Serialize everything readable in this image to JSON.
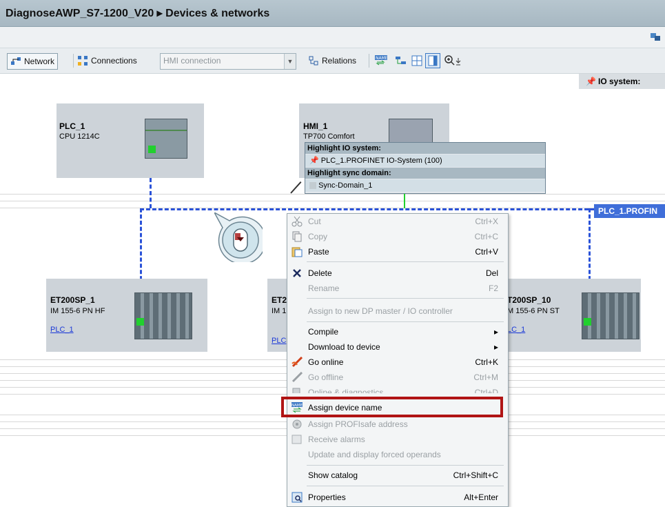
{
  "window": {
    "title": "DiagnoseAWP_S7-1200_V20  ▸  Devices & networks"
  },
  "toolbar": {
    "network": "Network",
    "connections": "Connections",
    "hmi_placeholder": "HMI connection",
    "relations": "Relations"
  },
  "io_header": {
    "label": "IO system:"
  },
  "devices": [
    {
      "name": "PLC_1",
      "type": "CPU 1214C",
      "link": ""
    },
    {
      "name": "HMI_1",
      "type": "TP700 Comfort",
      "link": ""
    },
    {
      "name": "ET200SP_1",
      "type": "IM 155-6 PN HF",
      "link": "PLC_1"
    },
    {
      "name": "ET2",
      "type": "IM 1",
      "link": "PLC"
    },
    {
      "name": "T200SP_10",
      "type": "M 155-6 PN ST",
      "link": "LC_1"
    }
  ],
  "network_label": "PLC_1.PROFIN",
  "tooltip": {
    "io_header": "Highlight IO system:",
    "io_item": "PLC_1.PROFINET IO-System (100)",
    "sync_header": "Highlight sync domain:",
    "sync_item": "Sync-Domain_1"
  },
  "menu": [
    {
      "label": "Cut",
      "shortcut": "Ctrl+X",
      "enabled": false,
      "icon": "cut-icon"
    },
    {
      "label": "Copy",
      "shortcut": "Ctrl+C",
      "enabled": false,
      "icon": "copy-icon"
    },
    {
      "label": "Paste",
      "shortcut": "Ctrl+V",
      "enabled": true,
      "icon": "paste-icon"
    },
    {
      "label": "Delete",
      "shortcut": "Del",
      "enabled": true,
      "icon": "delete-icon"
    },
    {
      "label": "Rename",
      "shortcut": "F2",
      "enabled": false,
      "icon": ""
    },
    {
      "label": "Assign to new DP master / IO controller",
      "shortcut": "",
      "enabled": false,
      "icon": ""
    },
    {
      "label": "Compile",
      "shortcut": "▸",
      "enabled": true,
      "icon": ""
    },
    {
      "label": "Download to device",
      "shortcut": "▸",
      "enabled": true,
      "icon": ""
    },
    {
      "label": "Go online",
      "shortcut": "Ctrl+K",
      "enabled": true,
      "icon": "go-online-icon"
    },
    {
      "label": "Go offline",
      "shortcut": "Ctrl+M",
      "enabled": false,
      "icon": "go-offline-icon"
    },
    {
      "label": "Online & diagnostics",
      "shortcut": "Ctrl+D",
      "enabled": false,
      "icon": "diagnostics-icon"
    },
    {
      "label": "Assign device name",
      "shortcut": "",
      "enabled": true,
      "icon": "assign-name-icon"
    },
    {
      "label": "Assign PROFIsafe address",
      "shortcut": "",
      "enabled": false,
      "icon": "profisafe-icon"
    },
    {
      "label": "Receive alarms",
      "shortcut": "",
      "enabled": false,
      "icon": "alarms-icon"
    },
    {
      "label": "Update and display forced operands",
      "shortcut": "",
      "enabled": false,
      "icon": ""
    },
    {
      "label": "Show catalog",
      "shortcut": "Ctrl+Shift+C",
      "enabled": true,
      "icon": ""
    },
    {
      "label": "Properties",
      "shortcut": "Alt+Enter",
      "enabled": true,
      "icon": "properties-icon"
    }
  ],
  "colors": {
    "highlight": "#b01414",
    "network": "#2a52d8",
    "accent_green": "#21d02e"
  }
}
